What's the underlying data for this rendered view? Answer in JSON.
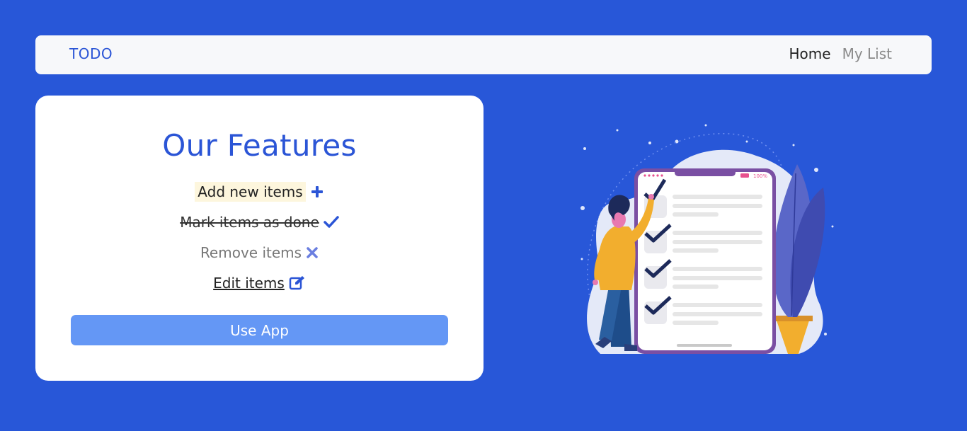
{
  "navbar": {
    "brand": "TODO",
    "links": [
      "Home",
      "My List"
    ]
  },
  "features": {
    "title": "Our Features",
    "items": [
      {
        "label": "Add new items",
        "icon": "plus-icon"
      },
      {
        "label": "Mark items as done",
        "icon": "check-icon"
      },
      {
        "label": "Remove items",
        "icon": "x-icon"
      },
      {
        "label": "Edit items",
        "icon": "edit-icon"
      }
    ],
    "button_label": "Use App"
  },
  "illustration": {
    "phone_status": "100%"
  },
  "colors": {
    "background": "#2857d8",
    "accent": "#2b55d6",
    "button": "#6497f5",
    "highlight": "#fdf6dd"
  }
}
